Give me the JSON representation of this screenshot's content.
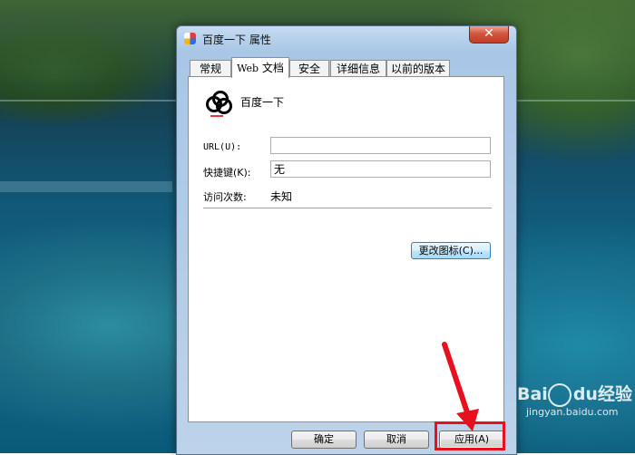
{
  "window": {
    "title": "百度一下 属性",
    "close_glyph": "✕"
  },
  "tabs": [
    {
      "label": "常规"
    },
    {
      "label_latin": "Web",
      "label_cn": "文档"
    },
    {
      "label": "安全"
    },
    {
      "label": "详细信息"
    },
    {
      "label": "以前的版本"
    }
  ],
  "active_tab": "Web 文档",
  "panel": {
    "item_name": "百度一下",
    "url_label_cn": "",
    "url_label": "URL(U):",
    "url_value": "",
    "shortcut_label": "快捷键(K):",
    "shortcut_value": "无",
    "visits_label": "访问次数:",
    "visits_value": "未知",
    "change_icon_button": "更改图标(C)..."
  },
  "footer": {
    "ok": "确定",
    "cancel": "取消",
    "apply": "应用(A)"
  },
  "annotation": {
    "color": "#e8101f"
  },
  "watermark": {
    "brand": "Bai",
    "brand2": "du",
    "product": "经验",
    "site": "jingyan.baidu.com"
  }
}
